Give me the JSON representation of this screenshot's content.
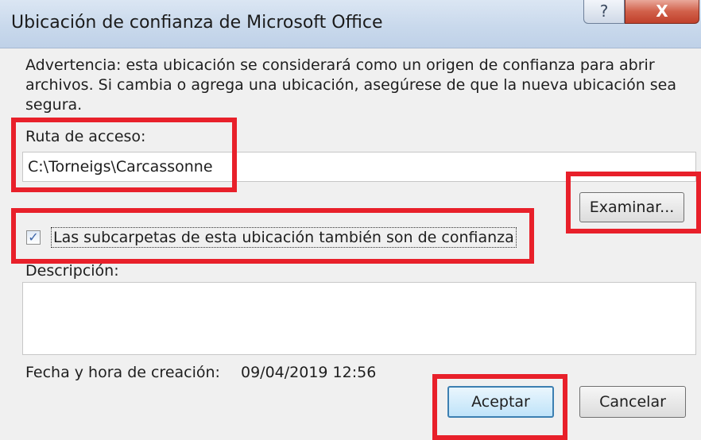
{
  "window": {
    "title": "Ubicación de confianza de Microsoft Office",
    "help_label": "?",
    "close_label": "X"
  },
  "warning_text": "Advertencia: esta ubicación se considerará como un origen de confianza para abrir archivos. Si cambia o agrega una ubicación, asegúrese de que la nueva ubicación sea segura.",
  "path": {
    "label": "Ruta de acceso:",
    "value": "C:\\Torneigs\\Carcassonne"
  },
  "browse_button": "Examinar...",
  "subfolders": {
    "checked": true,
    "label": "Las subcarpetas de esta ubicación también son de confianza"
  },
  "description": {
    "label": "Descripción:",
    "value": ""
  },
  "creation": {
    "label": "Fecha y hora de creación:",
    "value": "09/04/2019 12:56"
  },
  "buttons": {
    "ok": "Aceptar",
    "cancel": "Cancelar"
  },
  "colors": {
    "highlight": "#e8202a",
    "close_button": "#c0402b"
  }
}
